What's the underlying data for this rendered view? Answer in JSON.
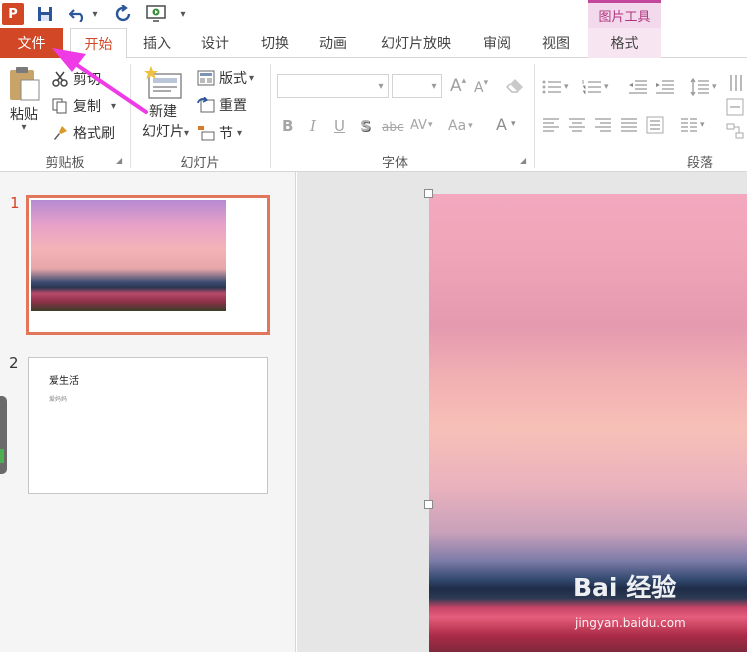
{
  "qat": {
    "app_logo": "P",
    "icons": [
      "powerpoint-logo",
      "save-icon",
      "undo-icon",
      "dropdown-arrow",
      "redo-icon",
      "from-beginning-icon",
      "customize-arrow"
    ]
  },
  "contextual_tab": {
    "header": "图片工具"
  },
  "tabs": [
    {
      "label": "文件"
    },
    {
      "label": "开始"
    },
    {
      "label": "插入"
    },
    {
      "label": "设计"
    },
    {
      "label": "切换"
    },
    {
      "label": "动画"
    },
    {
      "label": "幻灯片放映"
    },
    {
      "label": "审阅"
    },
    {
      "label": "视图"
    },
    {
      "label": "格式"
    }
  ],
  "ribbon": {
    "clipboard": {
      "paste": "粘贴",
      "cut": "剪切",
      "copy": "复制",
      "format_painter": "格式刷",
      "group_label": "剪贴板"
    },
    "slides": {
      "new_slide_line1": "新建",
      "new_slide_line2": "幻灯片",
      "layout": "版式",
      "reset": "重置",
      "section": "节",
      "group_label": "幻灯片"
    },
    "font": {
      "group_label": "字体",
      "font_name_value": "",
      "font_size_value": "",
      "bold": "B",
      "italic": "I",
      "underline": "U",
      "shadow": "S",
      "strikethrough": "abc",
      "spacing": "AV",
      "change_case": "Aa",
      "grow": "A",
      "shrink": "A",
      "font_color": "A"
    },
    "paragraph": {
      "group_label": "段落"
    }
  },
  "thumbnails": [
    {
      "number": "1"
    },
    {
      "number": "2",
      "title": "爱生活",
      "subtitle": "爱妈妈"
    }
  ],
  "watermark": {
    "logo": "Bai 经验",
    "url": "jingyan.baidu.com"
  },
  "colors": {
    "accent": "#d24726",
    "contextual": "#c3489b",
    "annotation_arrow": "#ee3be6"
  }
}
